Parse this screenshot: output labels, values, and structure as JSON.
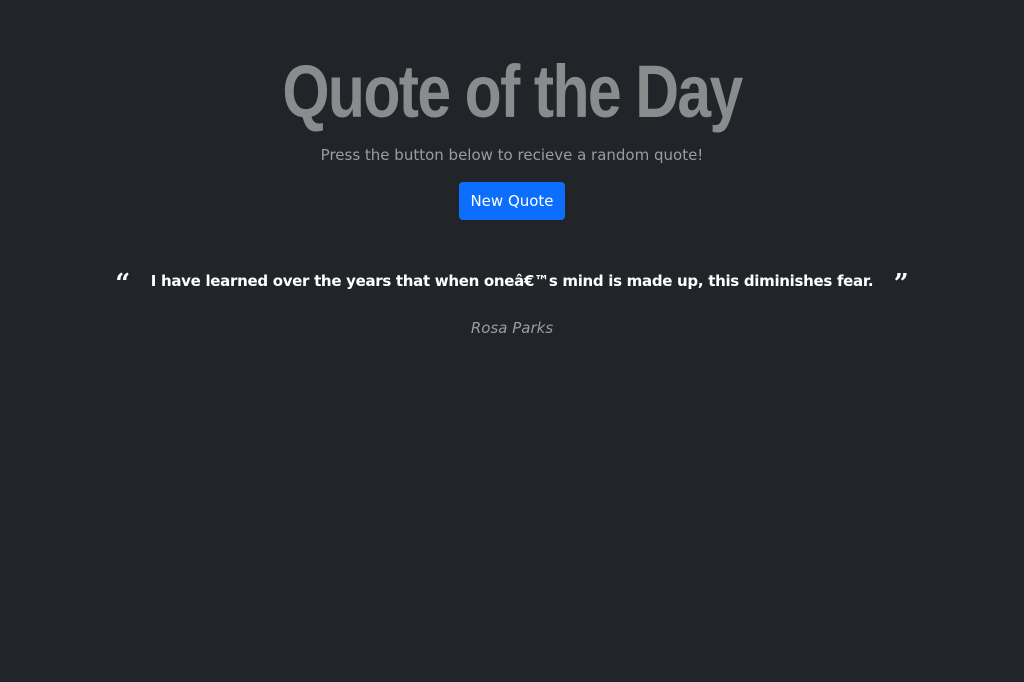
{
  "header": {
    "title": "Quote of the Day",
    "subtitle": "Press the button below to recieve a random quote!"
  },
  "actions": {
    "new_quote_label": "New Quote"
  },
  "quote": {
    "open_mark": "“",
    "text": "I have learned over the years that when oneâ€™s mind is made up, this diminishes fear.",
    "close_mark": "”",
    "author": "Rosa Parks"
  },
  "colors": {
    "background": "#212529",
    "title": "#8a8b8d",
    "button": "#0d6efd",
    "quote_text": "#ffffff",
    "muted_text": "#9a9ca0"
  },
  "icons": {
    "open_quote": "quote-left-icon",
    "close_quote": "quote-right-icon"
  }
}
